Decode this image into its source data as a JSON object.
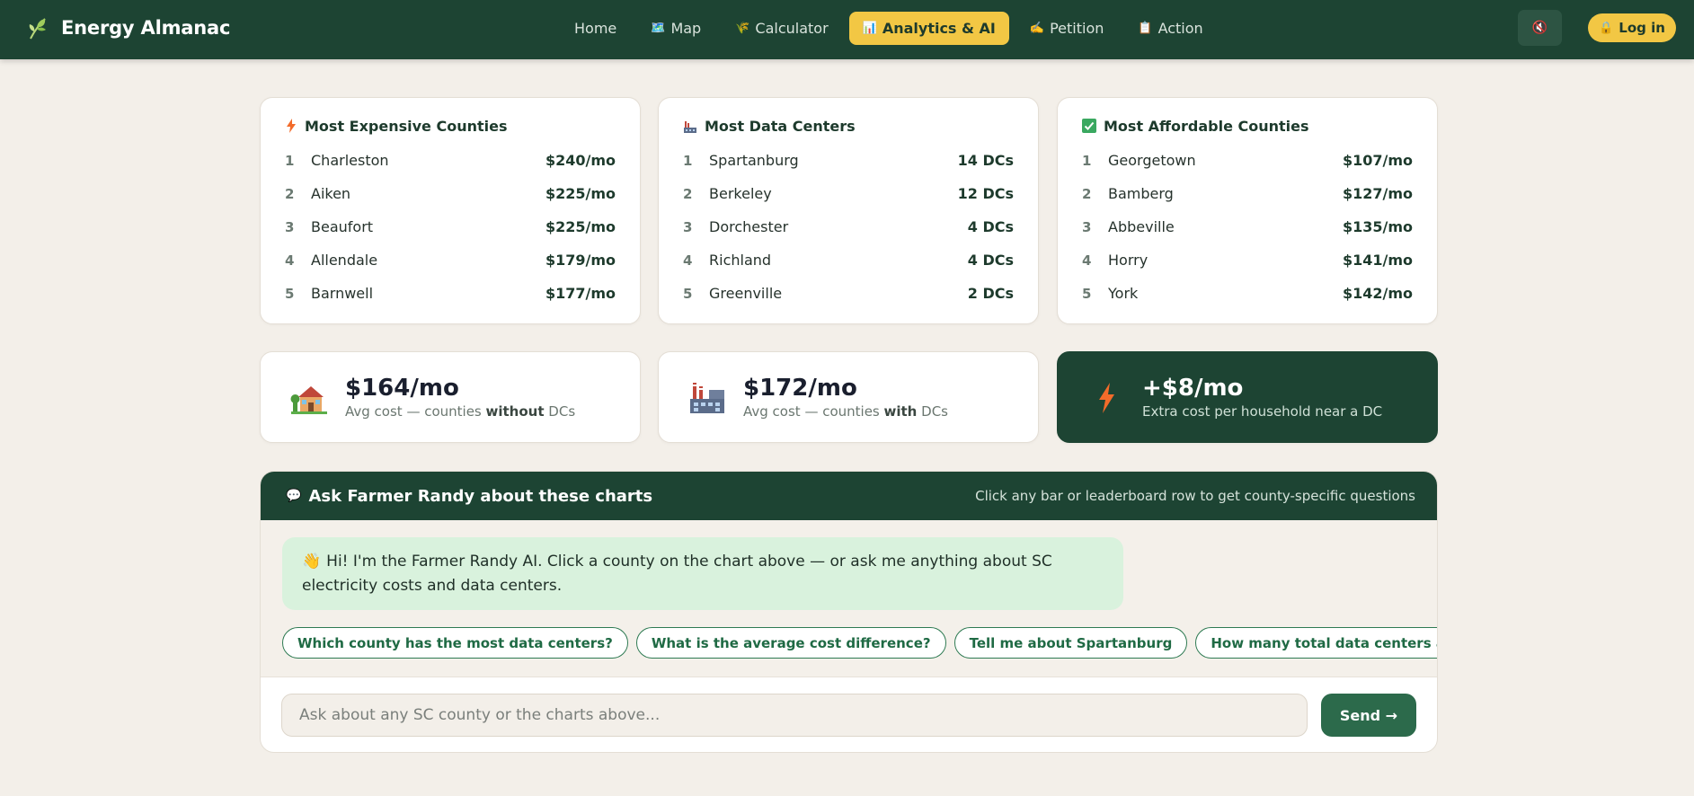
{
  "app": {
    "name": "Energy Almanac"
  },
  "nav": {
    "items": [
      {
        "label": "Home",
        "icon": ""
      },
      {
        "label": "Map",
        "icon": "🗺️"
      },
      {
        "label": "Calculator",
        "icon": "🌾"
      },
      {
        "label": "Analytics & AI",
        "icon": "📊"
      },
      {
        "label": "Petition",
        "icon": "✍️"
      },
      {
        "label": "Action",
        "icon": "📋"
      }
    ],
    "active_index": 3,
    "mute_icon": "🔇",
    "login_label": "Log in",
    "login_icon": "🔒"
  },
  "leaderboards": [
    {
      "title": "Most Expensive Counties",
      "icon": "lightning-icon",
      "rows": [
        {
          "rank": "1",
          "name": "Charleston",
          "value": "$240/mo"
        },
        {
          "rank": "2",
          "name": "Aiken",
          "value": "$225/mo"
        },
        {
          "rank": "3",
          "name": "Beaufort",
          "value": "$225/mo"
        },
        {
          "rank": "4",
          "name": "Allendale",
          "value": "$179/mo"
        },
        {
          "rank": "5",
          "name": "Barnwell",
          "value": "$177/mo"
        }
      ]
    },
    {
      "title": "Most Data Centers",
      "icon": "factory-icon",
      "rows": [
        {
          "rank": "1",
          "name": "Spartanburg",
          "value": "14 DCs"
        },
        {
          "rank": "2",
          "name": "Berkeley",
          "value": "12 DCs"
        },
        {
          "rank": "3",
          "name": "Dorchester",
          "value": "4 DCs"
        },
        {
          "rank": "4",
          "name": "Richland",
          "value": "4 DCs"
        },
        {
          "rank": "5",
          "name": "Greenville",
          "value": "2 DCs"
        }
      ]
    },
    {
      "title": "Most Affordable Counties",
      "icon": "check-icon",
      "rows": [
        {
          "rank": "1",
          "name": "Georgetown",
          "value": "$107/mo"
        },
        {
          "rank": "2",
          "name": "Bamberg",
          "value": "$127/mo"
        },
        {
          "rank": "3",
          "name": "Abbeville",
          "value": "$135/mo"
        },
        {
          "rank": "4",
          "name": "Horry",
          "value": "$141/mo"
        },
        {
          "rank": "5",
          "name": "York",
          "value": "$142/mo"
        }
      ]
    }
  ],
  "stats": [
    {
      "value": "$164/mo",
      "label_pre": "Avg cost — counties ",
      "label_bold": "without",
      "label_post": " DCs",
      "icon": "house-icon"
    },
    {
      "value": "$172/mo",
      "label_pre": "Avg cost — counties ",
      "label_bold": "with",
      "label_post": " DCs",
      "icon": "factory-icon"
    },
    {
      "value": "+$8/mo",
      "label": "Extra cost per household near a DC",
      "icon": "lightning-icon"
    }
  ],
  "chat": {
    "title": "Ask Farmer Randy about these charts",
    "title_icon": "💬",
    "hint": "Click any bar or leaderboard row to get county-specific questions",
    "greeting_icon": "👋",
    "greeting": "Hi! I'm the Farmer Randy AI. Click a county on the chart above — or ask me anything about SC electricity costs and data centers.",
    "chips": [
      "Which county has the most data centers?",
      "What is the average cost difference?",
      "Tell me about Spartanburg",
      "How many total data centers are in SC?"
    ],
    "input_placeholder": "Ask about any SC county or the charts above...",
    "send_label": "Send →"
  },
  "colors": {
    "brand_green": "#1d4433",
    "accent_yellow": "#f2c744",
    "chip_green": "#2e7a52",
    "bubble_green": "#d9f2dd",
    "lightning_orange": "#f26b2a"
  }
}
